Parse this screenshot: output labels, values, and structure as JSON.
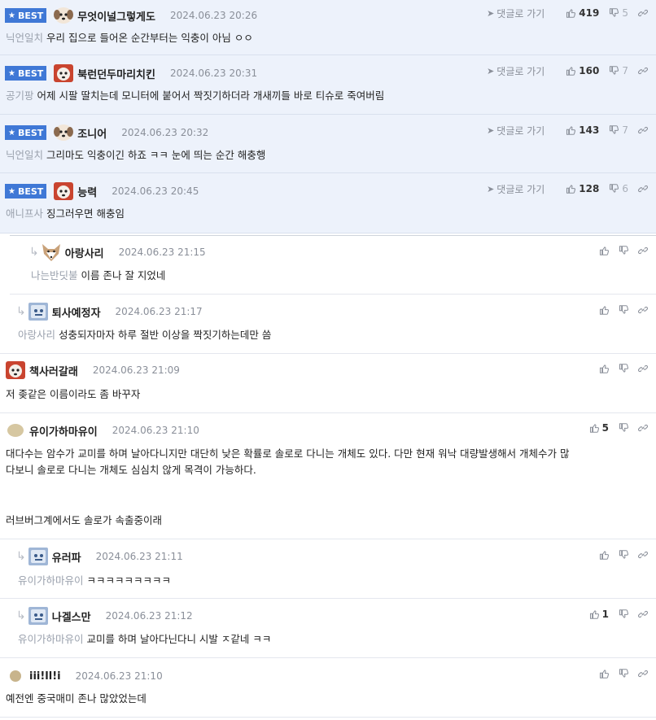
{
  "labels": {
    "best": "BEST",
    "goto": "댓글로 가기"
  },
  "comments": [
    {
      "nick": "무엇이널그렇게도",
      "date": "2024.06.23 20:26",
      "target": "닉언일치",
      "text": "우리 집으로 들어온 순간부터는 익충이 아님 ㅇㅇ",
      "up": "419",
      "down": "5"
    },
    {
      "nick": "북런던두마리치킨",
      "date": "2024.06.23 20:31",
      "target": "공기팡",
      "text": "어제 시팔 딸치는데 모니터에 붙어서 짝짓기하더라 개새끼들 바로 티슈로 죽여버림",
      "up": "160",
      "down": "7"
    },
    {
      "nick": "조니어",
      "date": "2024.06.23 20:32",
      "target": "닉언일치",
      "text": "그리마도 익충이긴 하죠 ㅋㅋ 눈에 띄는 순간 해충행",
      "up": "143",
      "down": "7"
    },
    {
      "nick": "능력",
      "date": "2024.06.23 20:45",
      "target": "애니프사",
      "text": "징그러우면 해충임",
      "up": "128",
      "down": "6"
    },
    {
      "nick": "아랑사리",
      "date": "2024.06.23 21:15",
      "target": "나는반딧불",
      "text": "이름 존나 잘 지었네"
    },
    {
      "nick": "퇴사예정자",
      "date": "2024.06.23 21:17",
      "target": "아랑사리",
      "text": "성충되자마자 하루 절반 이상을 짝짓기하는데만 씀"
    },
    {
      "nick": "책사러갈래",
      "date": "2024.06.23 21:09",
      "text": "저 좆같은 이름이라도 좀 바꾸자"
    },
    {
      "nick": "유이가하마유이",
      "date": "2024.06.23 21:10",
      "up": "5",
      "lines": [
        "대다수는 암수가 교미를 하며 날아다니지만 대단히 낮은 확률로 솔로로 다니는 개체도 있다. 다만 현재 워낙 대량발생해서 개체수가 많",
        "다보니 솔로로 다니는 개체도 심심치 않게 목격이 가능하다.",
        "러브버그계에서도 솔로가 속출중이래"
      ]
    },
    {
      "nick": "유러파",
      "date": "2024.06.23 21:11",
      "target": "유이가하마유이",
      "text": "ㅋㅋㅋㅋㅋㅋㅋㅋㅋ"
    },
    {
      "nick": "나겔스만",
      "date": "2024.06.23 21:12",
      "target": "유이가하마유이",
      "text": "교미를 하며 날아다닌다니 시발 ㅈ같네 ㅋㅋ",
      "up": "1"
    },
    {
      "nick": "iii!ll!i",
      "date": "2024.06.23 21:10",
      "text": "예전엔 중국매미 존나 많았었는데"
    }
  ],
  "colors": {
    "best_badge": "#3f78d6",
    "best_bg": "#edf2fb",
    "muted": "#9aa1ad"
  },
  "icons": [
    "star-icon",
    "send-icon",
    "thumbs-up-icon",
    "thumbs-down-icon",
    "link-icon",
    "reply-arrow-icon"
  ]
}
